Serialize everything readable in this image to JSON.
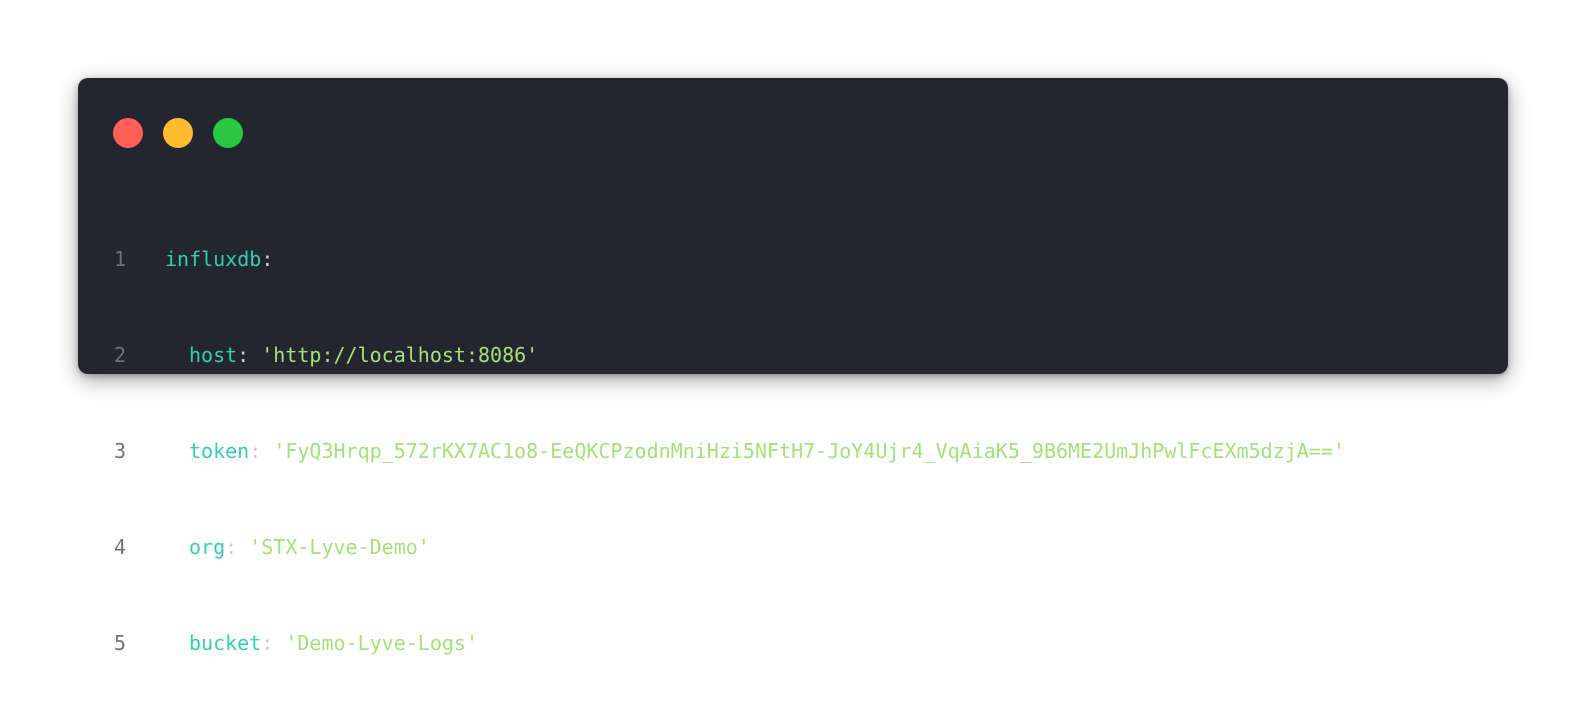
{
  "window_controls": {
    "close_color": "#ff5f57",
    "minimize_color": "#febc2e",
    "maximize_color": "#28c840"
  },
  "colors": {
    "background": "#23262f",
    "key": "#2fd1b2",
    "string": "#a6e07a",
    "line_number": "#6c7280"
  },
  "code": {
    "lines": [
      {
        "number": "1",
        "key": "influxdb",
        "value": ""
      },
      {
        "number": "2",
        "key": "host",
        "value": "'http://localhost:8086'"
      },
      {
        "number": "3",
        "key": "token",
        "value": "'FyQ3Hrqp_572rKX7AC1o8-EeQKCPzodnMniHzi5NFtH7-JoY4Ujr4_VqAiaK5_9B6ME2UmJhPwlFcEXm5dzjA=='"
      },
      {
        "number": "4",
        "key": "org",
        "value": "'STX-Lyve-Demo'"
      },
      {
        "number": "5",
        "key": "bucket",
        "value": "'Demo-Lyve-Logs'"
      }
    ]
  }
}
